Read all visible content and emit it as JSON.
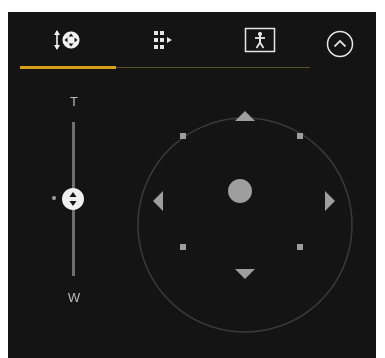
{
  "tabs": {
    "items": [
      {
        "icon": "pan-tilt-zoom-icon",
        "active": true
      },
      {
        "icon": "grid-icon",
        "active": false
      },
      {
        "icon": "framing-icon",
        "active": false
      }
    ],
    "accent_color": "#d6a019"
  },
  "collapse": {
    "icon": "chevron-up-circle-icon"
  },
  "zoom": {
    "tele_label": "T",
    "wide_label": "W",
    "level": 0.5
  },
  "pan_tilt": {
    "arrows": [
      "up",
      "down",
      "left",
      "right"
    ],
    "diagonals": [
      "up-left",
      "up-right",
      "down-left",
      "down-right"
    ]
  },
  "colors": {
    "panel_bg": "#141414",
    "control": "#9e9e9e",
    "ring": "#3a3a3a"
  }
}
